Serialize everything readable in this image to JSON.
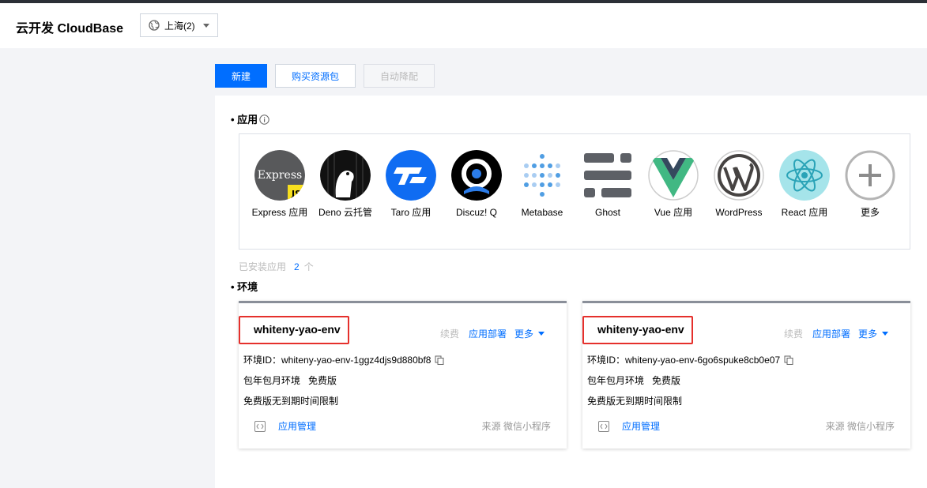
{
  "header": {
    "brand": "云开发 CloudBase",
    "region": "上海(2)"
  },
  "toolbar": {
    "new_label": "新建",
    "buy_label": "购买资源包",
    "auto_label": "自动降配"
  },
  "apps": {
    "title": "• 应用",
    "items": [
      {
        "label": "Express 应用",
        "icon": "express-icon"
      },
      {
        "label": "Deno 云托管",
        "icon": "deno-icon"
      },
      {
        "label": "Taro 应用",
        "icon": "taro-icon"
      },
      {
        "label": "Discuz! Q",
        "icon": "discuz-icon"
      },
      {
        "label": "Metabase",
        "icon": "metabase-icon"
      },
      {
        "label": "Ghost",
        "icon": "ghost-icon"
      },
      {
        "label": "Vue 应用",
        "icon": "vue-icon"
      },
      {
        "label": "WordPress",
        "icon": "wordpress-icon"
      },
      {
        "label": "React 应用",
        "icon": "react-icon"
      },
      {
        "label": "更多",
        "icon": "plus-icon"
      }
    ],
    "installed_label": "已安装应用",
    "installed_count": "2",
    "installed_unit": "个"
  },
  "envs": {
    "title": "• 环境",
    "cards": [
      {
        "name": "whiteny-yao-env",
        "renew": "续费",
        "deploy": "应用部署",
        "more": "更多",
        "env_id": "环境ID：whiteny-yao-env-1ggz4djs9d880bf8",
        "plan_type": "包年包月环境",
        "plan_tier": "免费版",
        "limit": "免费版无到期时间限制",
        "manage": "应用管理",
        "source": "来源 微信小程序"
      },
      {
        "name": "whiteny-yao-env",
        "renew": "续费",
        "deploy": "应用部署",
        "more": "更多",
        "env_id": "环境ID：whiteny-yao-env-6go6spuke8cb0e07",
        "plan_type": "包年包月环境",
        "plan_tier": "免费版",
        "limit": "免费版无到期时间限制",
        "manage": "应用管理",
        "source": "来源 微信小程序"
      }
    ]
  },
  "colors": {
    "primary": "#006eff",
    "highlight": "#e5302c"
  }
}
